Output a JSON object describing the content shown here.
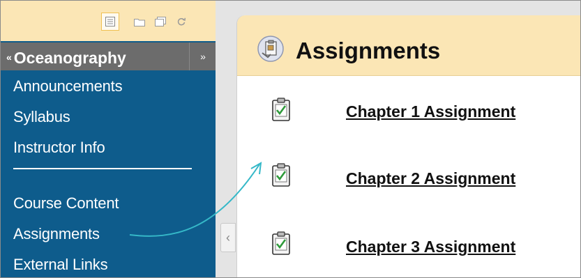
{
  "toolbar": {
    "buttons": [
      {
        "icon": "list-view-icon",
        "active": true
      },
      {
        "icon": "folder-view-icon",
        "active": false
      },
      {
        "icon": "window-icon",
        "active": false
      },
      {
        "icon": "refresh-icon",
        "active": false
      }
    ]
  },
  "course": {
    "title": "Oceanography",
    "collapse_glyph": "«",
    "expand_glyph": "»"
  },
  "menu": {
    "items": [
      {
        "label": "Announcements"
      },
      {
        "label": "Syllabus"
      },
      {
        "label": "Instructor Info"
      },
      {
        "label": "Course Content"
      },
      {
        "label": "Assignments"
      },
      {
        "label": "External Links"
      }
    ]
  },
  "collapse_handle_glyph": "‹",
  "page": {
    "title": "Assignments",
    "assignments": [
      {
        "label": "Chapter 1 Assignment"
      },
      {
        "label": "Chapter 2 Assignment"
      },
      {
        "label": "Chapter 3 Assignment"
      }
    ]
  },
  "colors": {
    "menu_bg": "#0e5c8c",
    "toolbar_bg": "#fbe6b5",
    "course_head_bg": "#6c6c6c",
    "callout_curve": "#35b8c8"
  }
}
